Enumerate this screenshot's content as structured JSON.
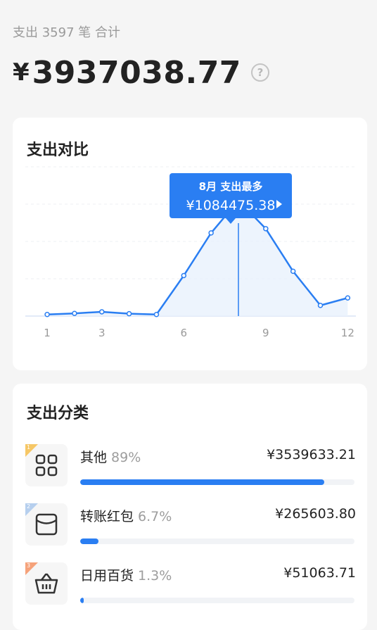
{
  "summary": {
    "label": "支出 3597 笔 合计",
    "currency": "¥",
    "total": "3937038.77",
    "help_icon": "question-circle-icon"
  },
  "chart_card": {
    "title": "支出对比",
    "tooltip_title": "8月 支出最多",
    "tooltip_amount": "¥1084475.38",
    "tooltip_icon": "play-arrow-icon",
    "accent_color": "#2a7ef2"
  },
  "chart_data": {
    "type": "area",
    "title": "支出对比",
    "x": [
      1,
      2,
      3,
      4,
      5,
      6,
      7,
      8,
      9,
      10,
      11,
      12
    ],
    "xticks": [
      "1",
      "3",
      "6",
      "9",
      "12"
    ],
    "tick_positions": [
      1,
      3,
      6,
      9,
      12
    ],
    "values": [
      15000,
      25000,
      40000,
      22000,
      15000,
      380000,
      780000,
      1084475.38,
      820000,
      420000,
      100000,
      170000
    ],
    "ylim": [
      0,
      1400000
    ],
    "grid": true,
    "highlight_month": 8
  },
  "category_card": {
    "title": "支出分类",
    "items": [
      {
        "rank": "1",
        "name": "其他",
        "percent": "89%",
        "amount": "¥3539633.21",
        "bar": 0.89,
        "icon": "grid-four-icon",
        "badge_color": "#f6c766"
      },
      {
        "rank": "2",
        "name": "转账红包",
        "percent": "6.7%",
        "amount": "¥265603.80",
        "bar": 0.067,
        "icon": "red-envelope-icon",
        "badge_color": "#b6cfee"
      },
      {
        "rank": "3",
        "name": "日用百货",
        "percent": "1.3%",
        "amount": "¥51063.71",
        "bar": 0.013,
        "icon": "shopping-basket-icon",
        "badge_color": "#f5a27a"
      }
    ]
  }
}
